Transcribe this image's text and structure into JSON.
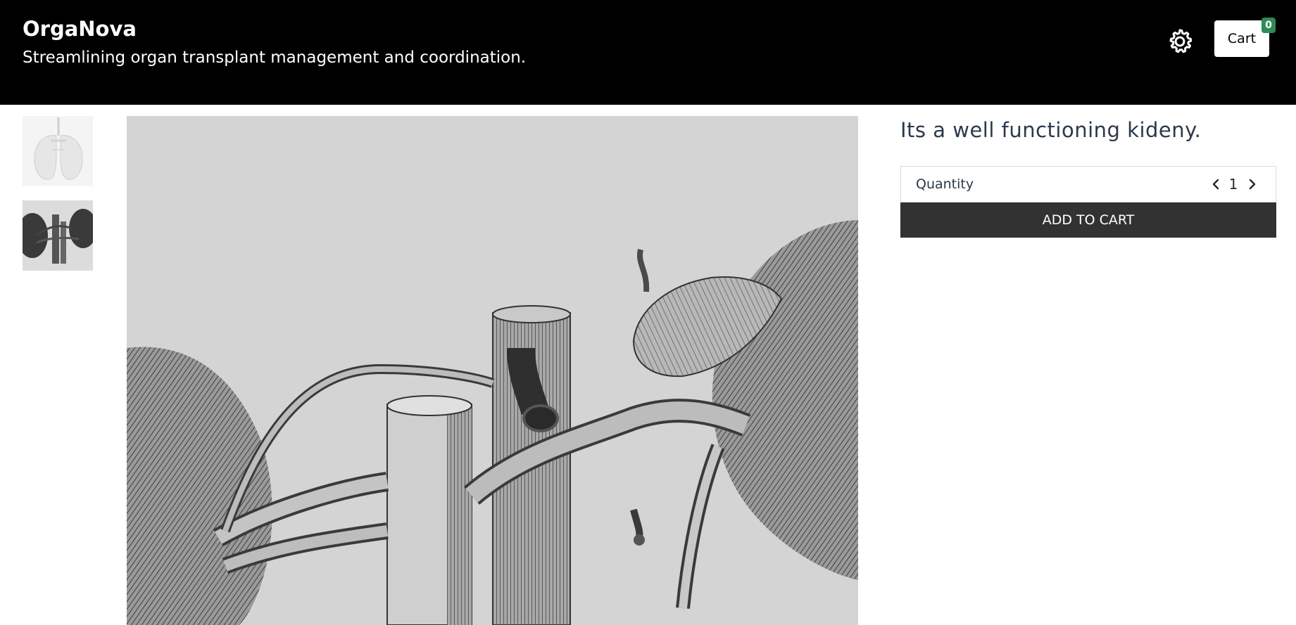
{
  "header": {
    "brand": "OrgaNova",
    "tagline": "Streamlining organ transplant management and coordination.",
    "settings_icon": "gear-icon",
    "cart_label": "Cart",
    "cart_count": "0"
  },
  "gallery": {
    "thumbnails": [
      {
        "icon": "lungs-illustration"
      },
      {
        "icon": "kidney-illustration"
      }
    ],
    "main_image_icon": "kidney-anatomy-engraving"
  },
  "product": {
    "title": "Its a well functioning kideny.",
    "quantity_label": "Quantity",
    "quantity_value": "1",
    "add_to_cart_label": "ADD TO CART"
  },
  "colors": {
    "header_bg": "#000000",
    "badge": "#2e8b57",
    "button_bg": "#323232"
  }
}
